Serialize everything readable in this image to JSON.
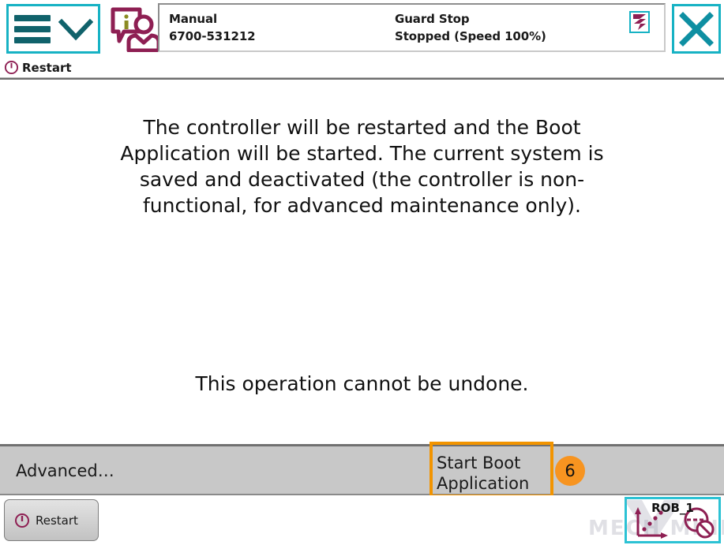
{
  "header": {
    "menu_button": {
      "icon": "hamburger-icon",
      "chevron": "chevron-down-icon"
    },
    "operator_icon": "info-operator-icon",
    "status": {
      "mode": "Manual",
      "controller_id": "6700-531212",
      "state": "Guard Stop",
      "motion": "Stopped (Speed 100%)",
      "guard_icon": "guard-stop-icon"
    },
    "close_label": "close-icon"
  },
  "taskbar": {
    "icon": "power-icon",
    "title": "Restart"
  },
  "content": {
    "message": "The controller will be restarted and the Boot Application will be started. The current system is saved and deactivated (the controller is non-functional, for advanced maintenance only).",
    "warning": "This operation cannot be undone."
  },
  "actionbar": {
    "advanced_label": "Advanced…",
    "boot_label": "Start Boot\nApplication",
    "badge": "6"
  },
  "bottombar": {
    "restart_label": "Restart",
    "restart_icon": "power-icon",
    "robot_name": "ROB_1",
    "jog_icon": "jog-coordinates-icon",
    "motors_icon": "motors-off-icon"
  },
  "watermark": {
    "text": "MECH MIND"
  },
  "colors": {
    "accent_teal": "#17b2c4",
    "dark_teal": "#10626b",
    "magenta": "#8e1f53",
    "highlight_orange": "#f29400",
    "badge_orange": "#f79420",
    "bar_grey": "#c8c8c8"
  }
}
